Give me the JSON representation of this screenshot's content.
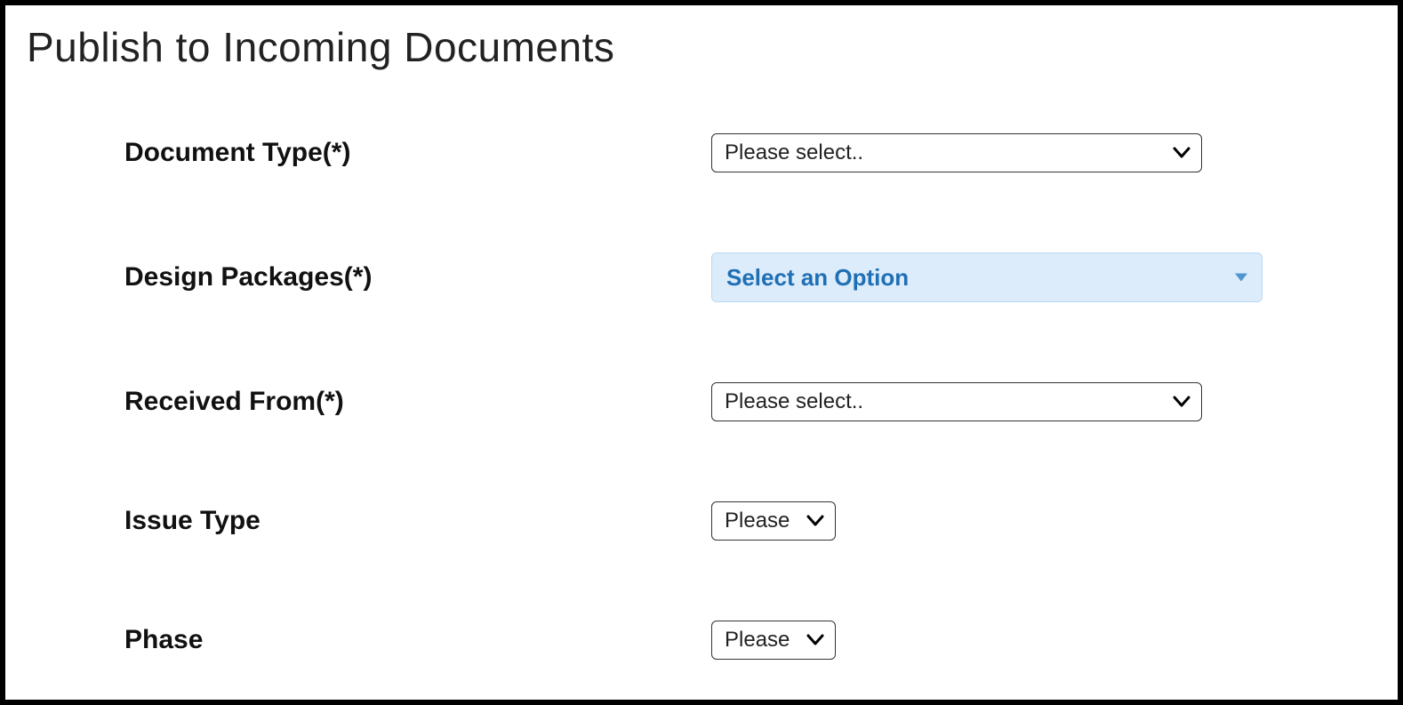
{
  "page": {
    "title": "Publish to Incoming Documents"
  },
  "form": {
    "documentType": {
      "label": "Document Type(*)",
      "value": "Please select.."
    },
    "designPackages": {
      "label": "Design Packages(*)",
      "value": "Select an Option"
    },
    "receivedFrom": {
      "label": "Received From(*)",
      "value": "Please select.."
    },
    "issueType": {
      "label": "Issue Type",
      "value": "Please"
    },
    "phase": {
      "label": "Phase",
      "value": "Please"
    }
  }
}
